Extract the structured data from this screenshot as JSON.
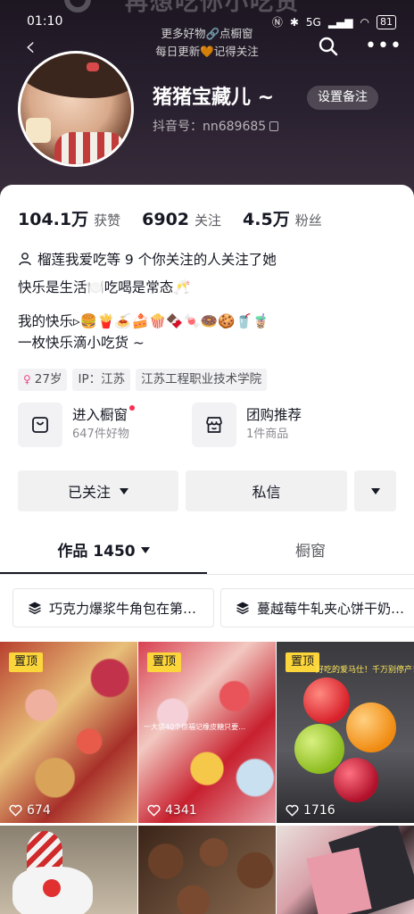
{
  "status_bar": {
    "time": "01:10",
    "network": "5G",
    "battery": "81"
  },
  "header": {
    "ghost_title": "再想吃你小吃货",
    "banner_line1": "更多好物🔗点橱窗",
    "banner_line2": "每日更新🧡记得关注",
    "nickname": "猪猪宝藏儿 ~",
    "remark_button": "设置备注",
    "douyin_id": "抖音号：nn689685"
  },
  "stats": [
    {
      "value": "104.1万",
      "label": "获赞"
    },
    {
      "value": "6902",
      "label": "关注"
    },
    {
      "value": "4.5万",
      "label": "粉丝"
    }
  ],
  "mutual_follow": "榴莲我爱吃等 9 个你关注的人关注了她",
  "bio": {
    "line1": "快乐是生活🍽️吃喝是常态🥂",
    "line2": "我的快乐▹🍔🍟🍝🍰🍿🍫🍬🍩🍪🥤🧋",
    "line3": "一枚快乐滴小吃货 ~"
  },
  "tags": {
    "age": "27岁",
    "ip": "IP：江苏",
    "school": "江苏工程职业技术学院"
  },
  "shop": {
    "window_title": "进入橱窗",
    "window_sub": "647件好物",
    "group_title": "团购推荐",
    "group_sub": "1件商品"
  },
  "actions": {
    "followed": "已关注",
    "message": "私信"
  },
  "tabs": {
    "works": "作品 1450",
    "showcase": "橱窗"
  },
  "collections": [
    {
      "label": "巧克力爆浆牛角包在第…"
    },
    {
      "label": "蔓越莓牛轧夹心饼干奶…"
    }
  ],
  "videos": [
    {
      "pinned": "置顶",
      "likes": "674",
      "overlay": ""
    },
    {
      "pinned": "置顶",
      "likes": "4341",
      "overlay": "一大袋40个徐福记橡皮糖只要…"
    },
    {
      "pinned": "置顶",
      "likes": "1716",
      "overlay": "好吃的爱马仕！千万别停产！"
    },
    {
      "likes": ""
    },
    {
      "likes": ""
    },
    {
      "likes": ""
    }
  ],
  "colors": {
    "accent": "#fe2c55",
    "pin": "#fcd53a",
    "hero_bg": "#241c28"
  }
}
